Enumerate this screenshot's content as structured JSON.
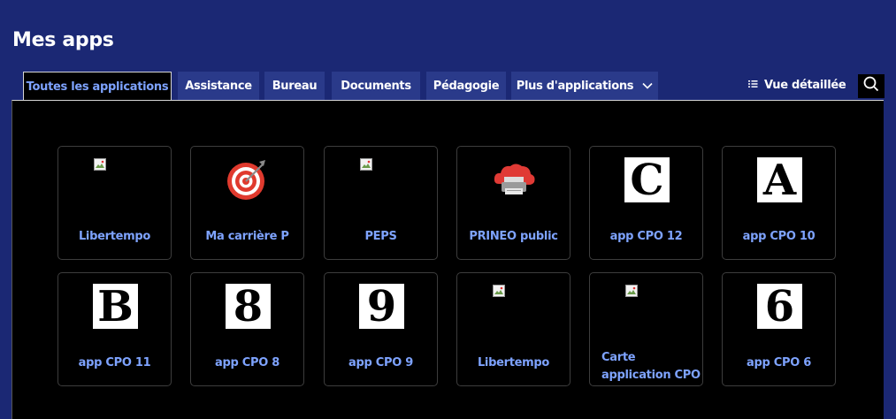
{
  "page": {
    "title": "Mes apps"
  },
  "tabs": [
    {
      "label": "Toutes les applications"
    },
    {
      "label": "Assistance"
    },
    {
      "label": "Bureau"
    },
    {
      "label": "Documents"
    },
    {
      "label": "Pédagogie"
    },
    {
      "label": "Plus d'applications"
    }
  ],
  "view_toggle": {
    "label": "Vue détaillée",
    "icon": "list-icon"
  },
  "search": {
    "icon": "search-icon"
  },
  "apps": [
    {
      "label": "Libertempo",
      "icon": "broken-image-icon"
    },
    {
      "label": "Ma carrière P",
      "icon": "target-icon"
    },
    {
      "label": "PEPS",
      "icon": "broken-image-icon"
    },
    {
      "label": "PRINEO public",
      "icon": "cloud-printer-icon"
    },
    {
      "label": "app CPO 12",
      "letter": "C"
    },
    {
      "label": "app CPO 10",
      "letter": "A"
    },
    {
      "label": "app CPO 11",
      "letter": "B"
    },
    {
      "label": "app CPO 8",
      "letter": "8"
    },
    {
      "label": "app CPO 9",
      "letter": "9"
    },
    {
      "label": "Libertempo",
      "icon": "broken-image-icon"
    },
    {
      "label": "Carte application CPO",
      "icon": "broken-image-icon"
    },
    {
      "label": "app CPO 6",
      "letter": "6"
    }
  ],
  "colors": {
    "background": "#1b2874",
    "tab": "#2a3a8a",
    "accent": "#7ea3ff",
    "panel": "#000000"
  }
}
